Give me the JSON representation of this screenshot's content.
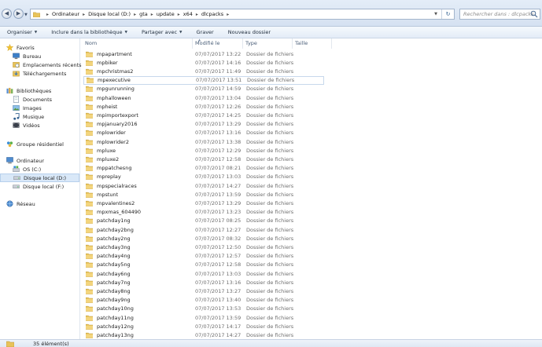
{
  "address": {
    "crumbs": [
      "Ordinateur",
      "Disque local (D:)",
      "gta",
      "update",
      "x64",
      "dlcpacks"
    ]
  },
  "search": {
    "placeholder": "Rechercher dans : dlcpacks"
  },
  "toolbar": {
    "organize": "Organiser",
    "include_library": "Inclure dans la bibliothèque",
    "share": "Partager avec",
    "burn": "Graver",
    "new_folder": "Nouveau dossier"
  },
  "nav": {
    "favorites": "Favoris",
    "favorites_items": [
      "Bureau",
      "Emplacements récents",
      "Téléchargements"
    ],
    "libraries": "Bibliothèques",
    "libraries_items": [
      "Documents",
      "Images",
      "Musique",
      "Vidéos"
    ],
    "homegroup": "Groupe résidentiel",
    "computer": "Ordinateur",
    "computer_items": [
      "OS (C:)",
      "Disque local (D:)",
      "Disque local (F:)"
    ],
    "network": "Réseau"
  },
  "columns": {
    "name": "Nom",
    "modified": "Modifié le",
    "type": "Type",
    "size": "Taille"
  },
  "files": [
    {
      "name": "mpapartment",
      "date": "07/07/2017 13:22",
      "type": "Dossier de fichiers"
    },
    {
      "name": "mpbiker",
      "date": "07/07/2017 14:16",
      "type": "Dossier de fichiers"
    },
    {
      "name": "mpchristmas2",
      "date": "07/07/2017 11:49",
      "type": "Dossier de fichiers"
    },
    {
      "name": "mpexecutive",
      "date": "07/07/2017 13:51",
      "type": "Dossier de fichiers"
    },
    {
      "name": "mpgunrunning",
      "date": "07/07/2017 14:59",
      "type": "Dossier de fichiers"
    },
    {
      "name": "mphalloween",
      "date": "07/07/2017 13:04",
      "type": "Dossier de fichiers"
    },
    {
      "name": "mpheist",
      "date": "07/07/2017 12:26",
      "type": "Dossier de fichiers"
    },
    {
      "name": "mpimportexport",
      "date": "07/07/2017 14:25",
      "type": "Dossier de fichiers"
    },
    {
      "name": "mpjanuary2016",
      "date": "07/07/2017 13:29",
      "type": "Dossier de fichiers"
    },
    {
      "name": "mplowrider",
      "date": "07/07/2017 13:16",
      "type": "Dossier de fichiers"
    },
    {
      "name": "mplowrider2",
      "date": "07/07/2017 13:38",
      "type": "Dossier de fichiers"
    },
    {
      "name": "mpluxe",
      "date": "07/07/2017 12:29",
      "type": "Dossier de fichiers"
    },
    {
      "name": "mpluxe2",
      "date": "07/07/2017 12:58",
      "type": "Dossier de fichiers"
    },
    {
      "name": "mppatchesng",
      "date": "07/07/2017 08:21",
      "type": "Dossier de fichiers"
    },
    {
      "name": "mpreplay",
      "date": "07/07/2017 13:03",
      "type": "Dossier de fichiers"
    },
    {
      "name": "mpspecialraces",
      "date": "07/07/2017 14:27",
      "type": "Dossier de fichiers"
    },
    {
      "name": "mpstunt",
      "date": "07/07/2017 13:59",
      "type": "Dossier de fichiers"
    },
    {
      "name": "mpvalentines2",
      "date": "07/07/2017 13:29",
      "type": "Dossier de fichiers"
    },
    {
      "name": "mpxmas_604490",
      "date": "07/07/2017 13:23",
      "type": "Dossier de fichiers"
    },
    {
      "name": "patchday1ng",
      "date": "07/07/2017 08:25",
      "type": "Dossier de fichiers"
    },
    {
      "name": "patchday2bng",
      "date": "07/07/2017 12:27",
      "type": "Dossier de fichiers"
    },
    {
      "name": "patchday2ng",
      "date": "07/07/2017 08:32",
      "type": "Dossier de fichiers"
    },
    {
      "name": "patchday3ng",
      "date": "07/07/2017 12:50",
      "type": "Dossier de fichiers"
    },
    {
      "name": "patchday4ng",
      "date": "07/07/2017 12:57",
      "type": "Dossier de fichiers"
    },
    {
      "name": "patchday5ng",
      "date": "07/07/2017 12:58",
      "type": "Dossier de fichiers"
    },
    {
      "name": "patchday6ng",
      "date": "07/07/2017 13:03",
      "type": "Dossier de fichiers"
    },
    {
      "name": "patchday7ng",
      "date": "07/07/2017 13:16",
      "type": "Dossier de fichiers"
    },
    {
      "name": "patchday8ng",
      "date": "07/07/2017 13:27",
      "type": "Dossier de fichiers"
    },
    {
      "name": "patchday9ng",
      "date": "07/07/2017 13:40",
      "type": "Dossier de fichiers"
    },
    {
      "name": "patchday10ng",
      "date": "07/07/2017 13:53",
      "type": "Dossier de fichiers"
    },
    {
      "name": "patchday11ng",
      "date": "07/07/2017 13:59",
      "type": "Dossier de fichiers"
    },
    {
      "name": "patchday12ng",
      "date": "07/07/2017 14:17",
      "type": "Dossier de fichiers"
    },
    {
      "name": "patchday13ng",
      "date": "07/07/2017 14:27",
      "type": "Dossier de fichiers"
    }
  ],
  "selected_file": "mpexecutive",
  "selected_drive": "Disque local (D:)",
  "status": {
    "count": "35 élément(s)"
  },
  "colors": {
    "folder": "#e8c35a",
    "selection": "#d9e8f8",
    "accent": "#2f5e8f"
  }
}
